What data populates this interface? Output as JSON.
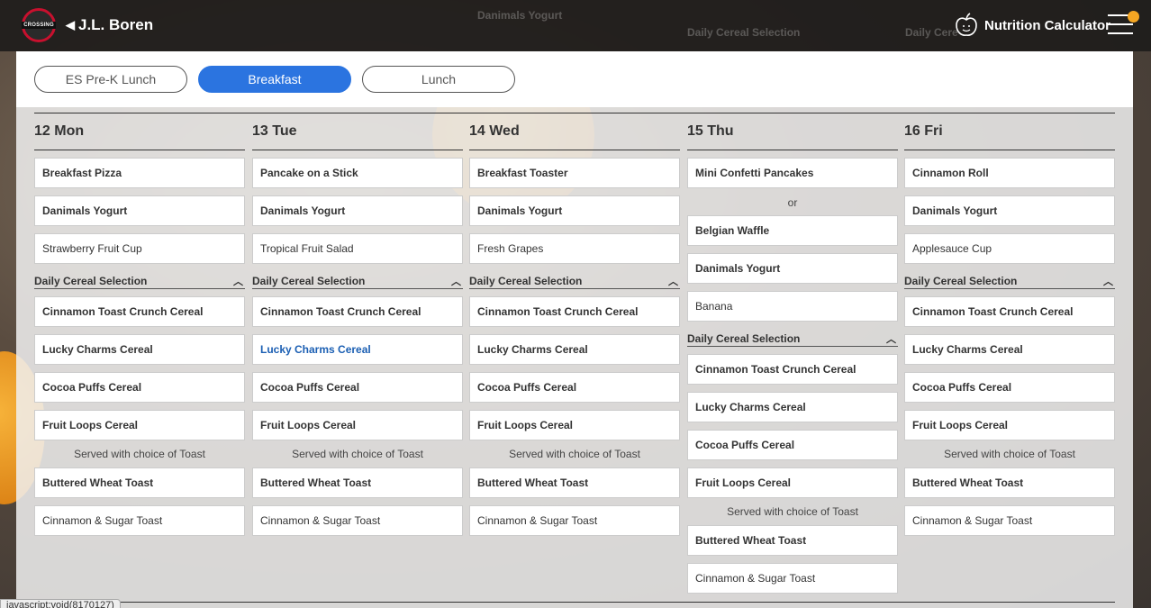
{
  "header": {
    "logo_text": "CROSSING",
    "school_name": "J.L. Boren",
    "nutrition_label": "Nutrition Calculator",
    "ghost_items": [
      "Danimals Yogurt",
      "Daily Cereal Selection",
      "Daily Cere"
    ]
  },
  "tabs": [
    {
      "label": "ES Pre-K Lunch",
      "active": false
    },
    {
      "label": "Breakfast",
      "active": true
    },
    {
      "label": "Lunch",
      "active": false
    }
  ],
  "days": [
    {
      "label": "12 Mon",
      "items": [
        "Breakfast Pizza",
        "Danimals Yogurt",
        "Strawberry Fruit Cup"
      ],
      "cereal_section": "Daily Cereal Selection",
      "cereals": [
        "Cinnamon Toast Crunch Cereal",
        "Lucky Charms Cereal",
        "Cocoa Puffs Cereal",
        "Fruit Loops Cereal"
      ],
      "toast_note": "Served with choice of Toast",
      "toasts": [
        "Buttered Wheat Toast",
        "Cinnamon & Sugar Toast"
      ]
    },
    {
      "label": "13 Tue",
      "items": [
        "Pancake on a Stick",
        "Danimals Yogurt",
        "Tropical Fruit Salad"
      ],
      "cereal_section": "Daily Cereal Selection",
      "cereals": [
        "Cinnamon Toast Crunch Cereal",
        "Lucky Charms Cereal",
        "Cocoa Puffs Cereal",
        "Fruit Loops Cereal"
      ],
      "toast_note": "Served with choice of Toast",
      "toasts": [
        "Buttered Wheat Toast",
        "Cinnamon & Sugar Toast"
      ]
    },
    {
      "label": "14 Wed",
      "items": [
        "Breakfast Toaster",
        "Danimals Yogurt",
        "Fresh Grapes"
      ],
      "cereal_section": "Daily Cereal Selection",
      "cereals": [
        "Cinnamon Toast Crunch Cereal",
        "Lucky Charms Cereal",
        "Cocoa Puffs Cereal",
        "Fruit Loops Cereal"
      ],
      "toast_note": "Served with choice of Toast",
      "toasts": [
        "Buttered Wheat Toast",
        "Cinnamon & Sugar Toast"
      ]
    },
    {
      "label": "15 Thu",
      "items_a": [
        "Mini Confetti Pancakes"
      ],
      "or_text": "or",
      "items_b": [
        "Belgian Waffle",
        "Danimals Yogurt",
        "Banana"
      ],
      "cereal_section": "Daily Cereal Selection",
      "cereals": [
        "Cinnamon Toast Crunch Cereal",
        "Lucky Charms Cereal",
        "Cocoa Puffs Cereal",
        "Fruit Loops Cereal"
      ],
      "toast_note": "Served with choice of Toast",
      "toasts": [
        "Buttered Wheat Toast",
        "Cinnamon & Sugar Toast"
      ]
    },
    {
      "label": "16 Fri",
      "items": [
        "Cinnamon Roll",
        "Danimals Yogurt",
        "Applesauce Cup"
      ],
      "cereal_section": "Daily Cereal Selection",
      "cereals": [
        "Cinnamon Toast Crunch Cereal",
        "Lucky Charms Cereal",
        "Cocoa Puffs Cereal",
        "Fruit Loops Cereal"
      ],
      "toast_note": "Served with choice of Toast",
      "toasts": [
        "Buttered Wheat Toast",
        "Cinnamon & Sugar Toast"
      ]
    }
  ],
  "status_bar": "javascript:void(8170127)",
  "colors": {
    "accent": "#2b74e0",
    "header_bg": "#1e1c1b",
    "link": "#1b5fb3",
    "notification": "#f5a623"
  }
}
